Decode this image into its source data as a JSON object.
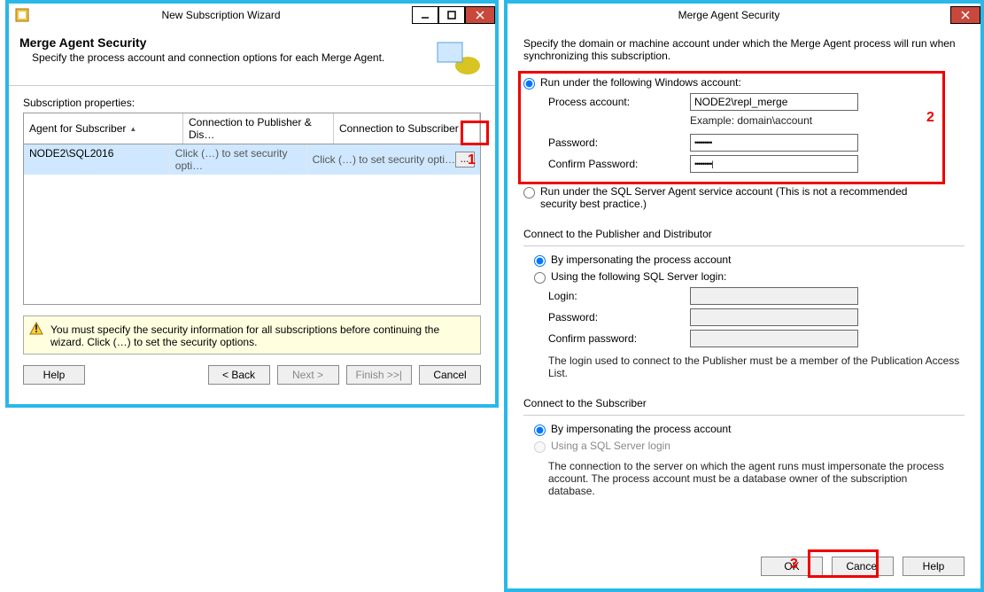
{
  "wizard": {
    "title": "New Subscription Wizard",
    "heading": "Merge Agent Security",
    "subheading": "Specify the process account and connection options for each Merge Agent.",
    "props_label": "Subscription properties:",
    "columns": {
      "c1": "Agent for Subscriber",
      "c2": "Connection to Publisher & Dis…",
      "c3": "Connection to Subscriber"
    },
    "row": {
      "agent": "NODE2\\SQL2016",
      "pub": "Click (…) to set security opti…",
      "sub": "Click (…) to set security opti…"
    },
    "warning": "You must specify the security information for all subscriptions before continuing the wizard. Click (…) to set the security options.",
    "buttons": {
      "help": "Help",
      "back": "< Back",
      "next": "Next >",
      "finish": "Finish >>|",
      "cancel": "Cancel"
    }
  },
  "sec": {
    "title": "Merge Agent Security",
    "intro": "Specify the domain or machine account under which the Merge Agent process will run when synchronizing this subscription.",
    "opt1": "Run under the following Windows account:",
    "process_account_label": "Process account:",
    "process_account_value": "NODE2\\repl_merge",
    "example": "Example: domain\\account",
    "password_label": "Password:",
    "confirm_label": "Confirm Password:",
    "password_value": "•••••••••",
    "confirm_value": "•••••••••|",
    "opt2": "Run under the SQL Server Agent service account (This is not a recommended security best practice.)",
    "pub_section": "Connect to the Publisher and Distributor",
    "pub_opt1": "By impersonating the process account",
    "pub_opt2": "Using the following SQL Server login:",
    "login_label": "Login:",
    "pass2_label": "Password:",
    "confirm2_label": "Confirm password:",
    "pub_note": "The login used to connect to the Publisher must be a member of the Publication Access List.",
    "sub_section": "Connect to the Subscriber",
    "sub_opt1": "By impersonating the process account",
    "sub_opt2": "Using a SQL Server login",
    "sub_note": "The connection to the server on which the agent runs must impersonate the process account. The process account must be a database owner of the subscription database.",
    "ok": "OK",
    "cancel": "Cancel",
    "help": "Help"
  },
  "annotations": {
    "a1": "1",
    "a2": "2",
    "a3": "3"
  }
}
